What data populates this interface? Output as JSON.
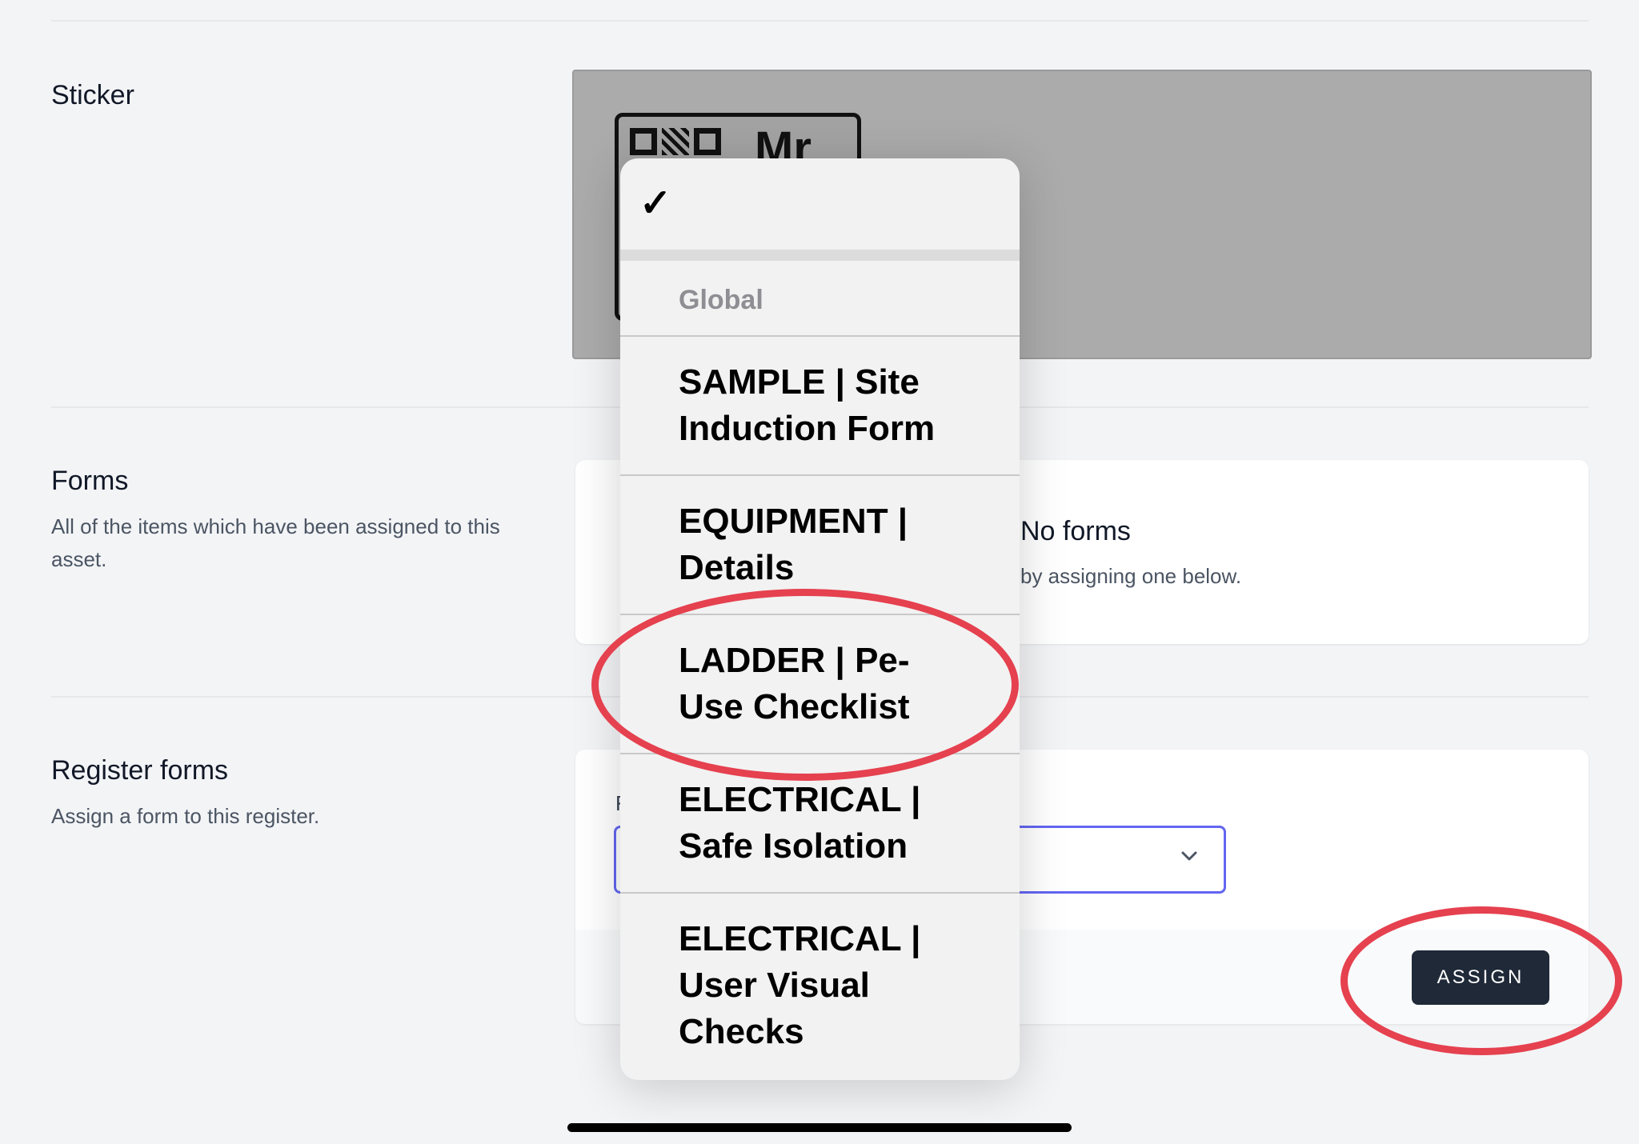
{
  "sections": {
    "sticker": {
      "title": "Sticker",
      "sticker_text": "Mr"
    },
    "forms": {
      "title": "Forms",
      "description": "All of the items which have been assigned to this asset.",
      "empty_title": "No forms",
      "empty_subtitle": "by assigning one below."
    },
    "register_forms": {
      "title": "Register forms",
      "description": "Assign a form to this register.",
      "field_label": "F",
      "select_value": "",
      "assign_label": "ASSIGN"
    }
  },
  "picker": {
    "selected_mark": "✓",
    "group_label": "Global",
    "options": [
      "SAMPLE | Site Induction Form",
      "EQUIPMENT | Details",
      "LADDER | Pe-Use Checklist",
      "ELECTRICAL | Safe Isolation",
      "ELECTRICAL | User Visual Checks"
    ]
  },
  "icons": {
    "select_chevron": "chevron-down-icon",
    "checkmark": "checkmark-icon"
  },
  "colors": {
    "annotation": "#e5414f",
    "accent": "#6366f1",
    "button_bg": "#1f2937"
  }
}
